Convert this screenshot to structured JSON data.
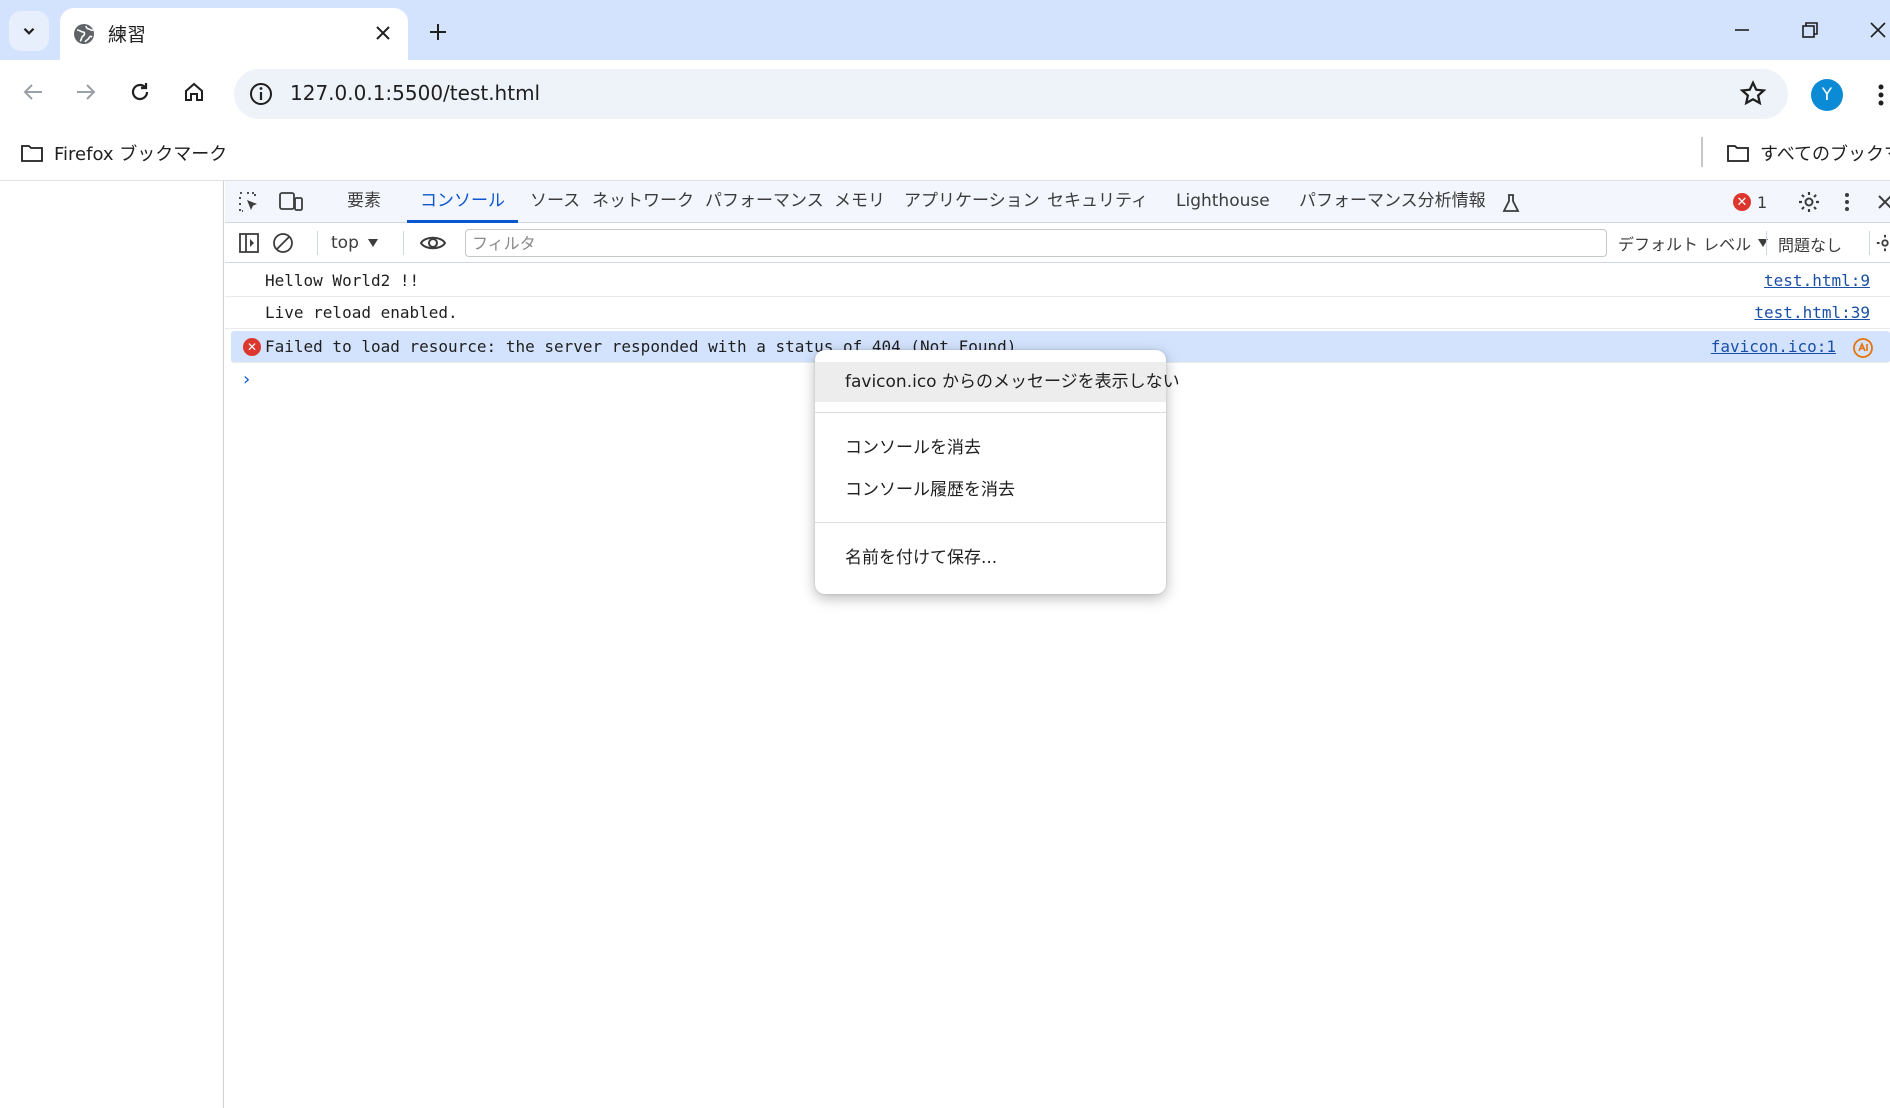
{
  "browser": {
    "tab": {
      "title": "練習"
    },
    "omnibox": {
      "url": "127.0.0.1:5500/test.html"
    },
    "avatar_letter": "Y",
    "bookmarks": {
      "left_folder": "Firefox ブックマーク",
      "right_folder": "すべてのブックマーク"
    }
  },
  "devtools": {
    "tabs": [
      {
        "label": "要素"
      },
      {
        "label": "コンソール"
      },
      {
        "label": "ソース"
      },
      {
        "label": "ネットワーク"
      },
      {
        "label": "パフォーマンス"
      },
      {
        "label": "メモリ"
      },
      {
        "label": "アプリケーション"
      },
      {
        "label": "セキュリティ"
      },
      {
        "label": "Lighthouse"
      },
      {
        "label": "パフォーマンス分析情報"
      }
    ],
    "active_tab": "コンソール",
    "error_count": "1",
    "toolbar": {
      "context": "top",
      "filter_placeholder": "フィルタ",
      "level": "デフォルト レベル",
      "issues": "問題なし"
    },
    "console": [
      {
        "type": "log",
        "message": "Hellow World2 !!",
        "source": "test.html:9"
      },
      {
        "type": "log",
        "message": "Live reload enabled.",
        "source": "test.html:39"
      },
      {
        "type": "error",
        "message": "Failed to load resource: the server responded with a status of 404 (Not Found)",
        "source": "favicon.ico:1"
      }
    ]
  },
  "context_menu": {
    "items": [
      {
        "label": "favicon.ico からのメッセージを表示しない"
      },
      {
        "label": "コンソールを消去"
      },
      {
        "label": "コンソール履歴を消去"
      },
      {
        "label": "名前を付けて保存..."
      }
    ]
  },
  "colors": {
    "tabstrip_bg": "#d3e3fd",
    "accent": "#0b57d0",
    "error": "#dc362e",
    "error_row_bg": "#d3e3fd"
  }
}
